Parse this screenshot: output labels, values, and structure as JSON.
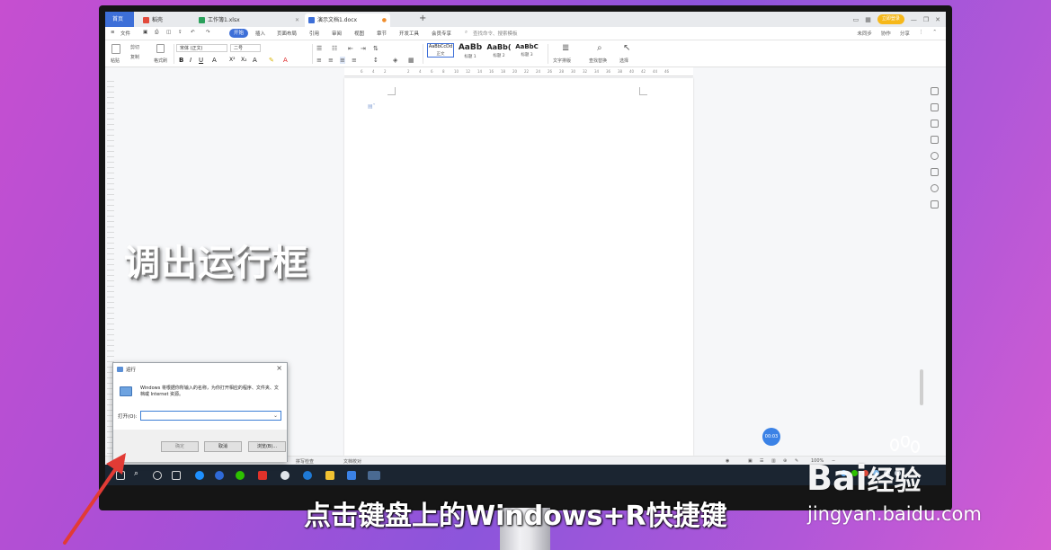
{
  "tabs": {
    "home": "首页",
    "straw": "稻壳",
    "sheet": "工作簿1.xlsx",
    "doc": "演示文档1.docx",
    "plus": "+"
  },
  "titlebar": {
    "login": "立即登录"
  },
  "menu": {
    "file": "文件",
    "items": [
      "开始",
      "插入",
      "页面布局",
      "引用",
      "审阅",
      "视图",
      "章节",
      "开发工具",
      "会员专享"
    ],
    "search": "查找命令、搜索模板",
    "right": [
      "未同步",
      "协作",
      "分享"
    ]
  },
  "ribbon": {
    "paste": "粘贴",
    "cut": "剪切",
    "copy": "复制",
    "format_painter": "格式刷",
    "font_name": "宋体 (正文)",
    "font_size": "二号",
    "styles": [
      {
        "sample": "AaBbCcDd",
        "label": "正文"
      },
      {
        "sample": "AaBb",
        "label": "标题 1"
      },
      {
        "sample": "AaBb(",
        "label": "标题 2"
      },
      {
        "sample": "AaBbC",
        "label": "标题 3"
      }
    ],
    "text_layout": "文字排版",
    "find_replace": "查找替换",
    "select": "选择"
  },
  "ruler_ticks": [
    "6",
    "4",
    "2",
    "",
    "2",
    "4",
    "6",
    "8",
    "10",
    "12",
    "14",
    "16",
    "18",
    "20",
    "22",
    "24",
    "26",
    "28",
    "30",
    "32",
    "34",
    "36",
    "38",
    "40",
    "42",
    "44",
    "46"
  ],
  "statusbar": {
    "spellcheck": "拼写检查",
    "proof": "文档校对",
    "zoom": "100%"
  },
  "timer": "00:03",
  "run_dialog": {
    "title": "运行",
    "description": "Windows 将根据你所输入的名称，为你打开相应的程序、文件夹、文档或 Internet 资源。",
    "open_label": "打开(O):",
    "ok": "确定",
    "cancel": "取消",
    "browse": "浏览(B)..."
  },
  "captions": {
    "left": "调出运行框",
    "bottom": "点击键盘上的Windows+R快捷键"
  },
  "watermark": {
    "logo": "Bai",
    "logo_cn": "经验",
    "url": "jingyan.baidu.com"
  },
  "colors": {
    "accent": "#3d6fd8",
    "taskbar": "#1b2531",
    "arrow": "#e23b35"
  }
}
